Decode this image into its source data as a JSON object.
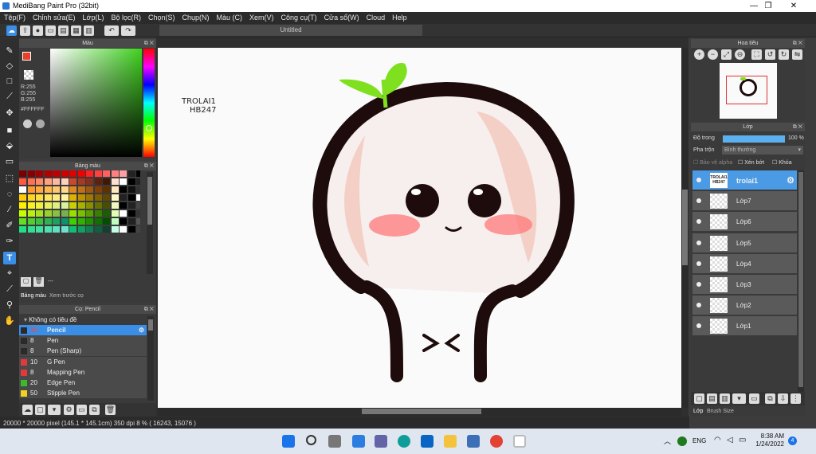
{
  "window": {
    "title": "MediBang Paint Pro (32bit)",
    "minimize": "—",
    "maximize": "❐",
    "close": "✕"
  },
  "menu": [
    "Tệp(F)",
    "Chỉnh sửa(E)",
    "Lớp(L)",
    "Bộ lọc(R)",
    "Chọn(S)",
    "Chụp(N)",
    "Màu (C)",
    "Xem(V)",
    "Công cụ(T)",
    "Cửa sổ(W)",
    "Cloud",
    "Help"
  ],
  "canvas_tab": "Untitled",
  "color_panel": {
    "title": "Màu",
    "r": "R:255",
    "g": "G:255",
    "b": "B:255",
    "hex": "#FFFFFF"
  },
  "palette_panel": {
    "title": "Bảng màu",
    "more": "---",
    "tab1": "Bảng màu",
    "tab2": "Xem trước cọ"
  },
  "brush_panel": {
    "title": "Cọ: Pencil",
    "group": "Không có tiêu đề",
    "brushes": [
      {
        "size": "10",
        "name": "Pencil",
        "color": "#2a2a2a",
        "selected": true
      },
      {
        "size": "8",
        "name": "Pen",
        "color": "#2a2a2a",
        "selected": false
      },
      {
        "size": "8",
        "name": "Pen (Sharp)",
        "color": "#2a2a2a",
        "selected": false
      },
      {
        "size": "10",
        "name": "G Pen",
        "color": "#e23a3a",
        "selected": false
      },
      {
        "size": "8",
        "name": "Mapping Pen",
        "color": "#e23a3a",
        "selected": false
      },
      {
        "size": "20",
        "name": "Edge Pen",
        "color": "#3cba2a",
        "selected": false
      },
      {
        "size": "50",
        "name": "Stipple Pen",
        "color": "#f0d020",
        "selected": false
      }
    ]
  },
  "navigator": {
    "title": "Hoa tiêu"
  },
  "layer_panel": {
    "title": "Lớp",
    "opacity_label": "Độ trong",
    "opacity_value": "100 %",
    "blend_label": "Pha trộn",
    "blend_value": "Bình thường",
    "protect_alpha": "Bảo vệ alpha",
    "clipping": "Xén bớt",
    "lock": "Khóa",
    "layers": [
      "trolai1",
      "Lớp7",
      "Lớp6",
      "Lớp5",
      "Lớp4",
      "Lớp3",
      "Lớp2",
      "Lớp1"
    ],
    "tab1": "Lớp",
    "tab2": "Brush Size"
  },
  "artwork": {
    "text_line1": "TROLAI1",
    "text_line2": "HB247",
    "thumb_text": "TROLAI1 HB247"
  },
  "status": {
    "canvas": "20000 * 20000 pixel   (145.1 * 145.1cm)   350 dpi   8 %   ( 16243, 15076 )"
  },
  "taskbar": {
    "lang": "ENG",
    "time": "8:38 AM",
    "date": "1/24/2022",
    "notif": "4"
  }
}
